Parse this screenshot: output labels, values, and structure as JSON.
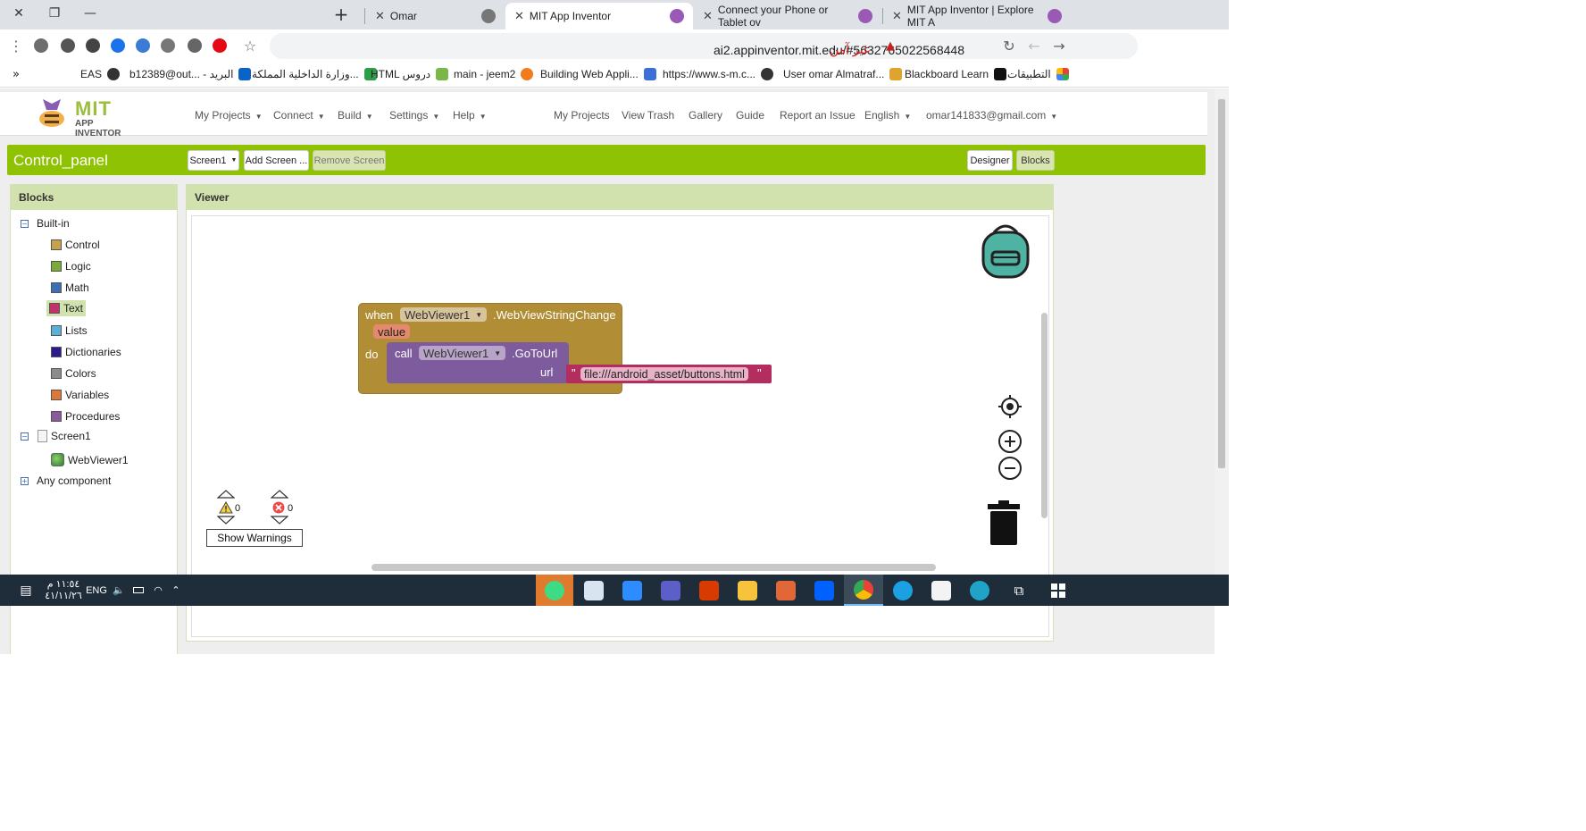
{
  "browser": {
    "tabs": [
      {
        "title": "Omar",
        "active": false
      },
      {
        "title": "MIT App Inventor",
        "active": true
      },
      {
        "title": "Connect your Phone or Tablet ov",
        "active": false
      },
      {
        "title": "MIT App Inventor | Explore MIT A",
        "active": false
      }
    ],
    "url": "ai2.appinventor.mit.edu/#5632765022568448",
    "security_label": "غير آمن",
    "bookmarks": [
      {
        "label": "EAS",
        "color": "#333333"
      },
      {
        "label": "b12389@out... - البريد",
        "color": "#0a64c8"
      },
      {
        "label": "وزارة الداخلية المملكة...",
        "color": "#2e9d4a"
      },
      {
        "label": "HTML دروس",
        "color": "#7ab648"
      },
      {
        "label": "main - jeem2",
        "color": "#f07c1b"
      },
      {
        "label": "Building Web Appli...",
        "color": "#3b6fd6"
      },
      {
        "label": "https://www.s-m.c...",
        "color": "#333333"
      },
      {
        "label": "User omar Almatraf...",
        "color": "#e0a32e"
      },
      {
        "label": "Blackboard Learn",
        "color": "#111111"
      },
      {
        "label": "التطبيقات",
        "color": "#e94235"
      }
    ]
  },
  "app": {
    "logo_mit": "MIT",
    "logo_sub": "APP INVENTOR",
    "menu_left": [
      "My Projects",
      "Connect",
      "Build",
      "Settings",
      "Help"
    ],
    "menu_right": [
      "My Projects",
      "View Trash",
      "Gallery",
      "Guide",
      "Report an Issue",
      "English",
      "omar141833@gmail.com"
    ],
    "project_name": "Control_panel",
    "screen_select": "Screen1",
    "add_screen": "Add Screen ...",
    "remove_screen": "Remove Screen",
    "designer": "Designer",
    "blocks": "Blocks"
  },
  "blocks_panel": {
    "title": "Blocks",
    "builtin": "Built-in",
    "items": [
      {
        "label": "Control",
        "color": "#c8a24a"
      },
      {
        "label": "Logic",
        "color": "#7aaa3a"
      },
      {
        "label": "Math",
        "color": "#3d6fb6"
      },
      {
        "label": "Text",
        "color": "#c0336b"
      },
      {
        "label": "Lists",
        "color": "#5bb0d8"
      },
      {
        "label": "Dictionaries",
        "color": "#2a1c8c"
      },
      {
        "label": "Colors",
        "color": "#8c8c8c"
      },
      {
        "label": "Variables",
        "color": "#e0773a"
      },
      {
        "label": "Procedures",
        "color": "#8a5a9c"
      }
    ],
    "screen": "Screen1",
    "component": "WebViewer1",
    "any_component": "Any component"
  },
  "viewer": {
    "title": "Viewer",
    "event": {
      "when": "when",
      "component": "WebViewer1",
      "event_name": ".WebViewStringChange",
      "param": "value",
      "do": "do"
    },
    "call": {
      "call": "call",
      "component": "WebViewer1",
      "method": ".GoToUrl",
      "arg": "url"
    },
    "string": {
      "open_quote": "\"",
      "value": "file:///android_asset/buttons.html",
      "close_quote": "\""
    },
    "warnings": {
      "warn_count": "0",
      "error_count": "0",
      "button": "Show Warnings"
    }
  },
  "taskbar": {
    "time": "١١:٥٤ م",
    "date": "٤١/١١/٢٦",
    "lang": "ENG"
  }
}
